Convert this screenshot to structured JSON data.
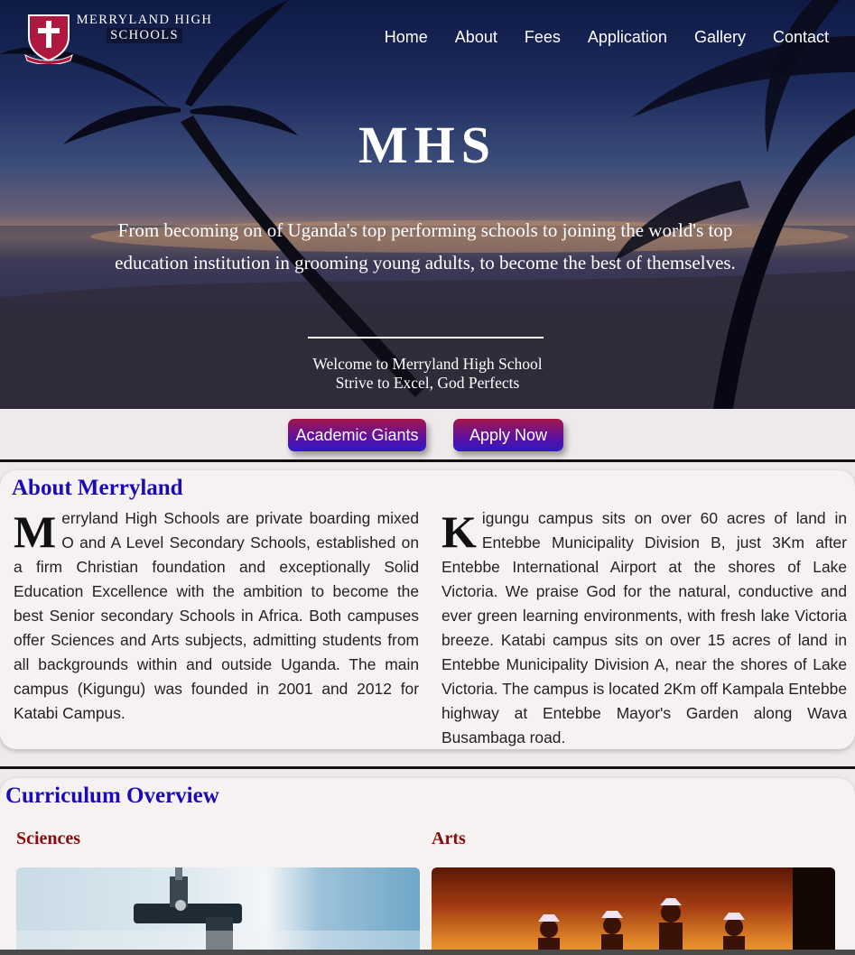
{
  "brand": {
    "line1": "MERRYLAND HIGH",
    "line2": "SCHOOLS"
  },
  "nav": [
    "Home",
    "About",
    "Fees",
    "Application",
    "Gallery",
    "Contact"
  ],
  "hero": {
    "title": "MHS",
    "tagline": "From becoming on of Uganda's top performing schools to joining the world's top education institution in grooming young adults, to become the best of themselves.",
    "welcome1": "Welcome to Merryland High School",
    "welcome2": "Strive to Excel, God Perfects"
  },
  "buttons": {
    "academic": "Academic Giants",
    "apply": "Apply Now"
  },
  "about": {
    "heading": "About Merryland",
    "col1_cap": "M",
    "col1_text": "erryland High Schools are private boarding mixed O and A Level Secondary Schools, established on a firm Christian foundation and exceptionally Solid Education Excellence with the ambition to become the best Senior secondary Schools in Africa. Both campuses offer Sciences and Arts subjects, admitting students from all backgrounds within and outside Uganda. The main campus (Kigungu) was founded in 2001 and 2012 for Katabi Campus.",
    "col2_cap": "K",
    "col2_text": "igungu campus sits on over 60 acres of land in Entebbe Municipality Division B, just 3Km after Entebbe International Airport at the shores of Lake Victoria. We praise God for the natural, conductive and ever green learning environments, with fresh lake Victoria breeze. Katabi campus sits on over 15 acres of land in Entebbe Municipality Division A, near the shores of Lake Victoria. The campus is located 2Km off Kampala Entebbe highway at Entebbe Mayor's Garden along Wava Busambaga road."
  },
  "curriculum": {
    "heading": "Curriculum Overview",
    "sciences": "Sciences",
    "arts": "Arts"
  },
  "colors": {
    "heading_blue": "#1a0ab9",
    "subheading_red": "#8b0b0b",
    "button_start": "#a3174a",
    "button_end": "#2f19c2"
  }
}
